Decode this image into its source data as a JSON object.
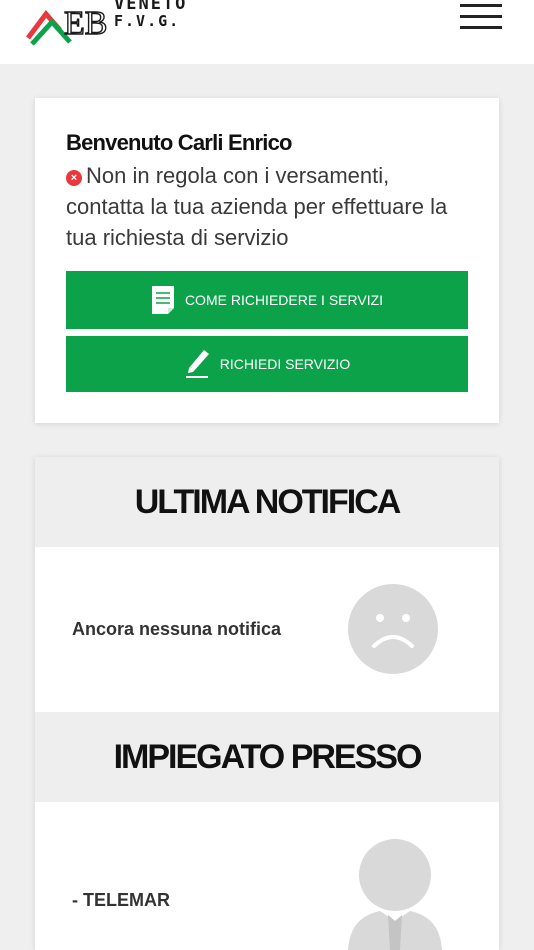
{
  "header": {
    "logo_top": "VENETO",
    "logo_bottom": "F.V.G."
  },
  "welcome": {
    "title": "Benvenuto Carli Enrico",
    "warning": "Non in regola con i versamenti, contatta la tua azienda per effettuare la tua richiesta di servizio",
    "buttons": [
      {
        "label": "COME RICHIEDERE I SERVIZI",
        "icon": "document-icon"
      },
      {
        "label": "RICHIEDI SERVIZIO",
        "icon": "pen-icon"
      }
    ]
  },
  "notifica": {
    "title": "ULTIMA NOTIFICA",
    "empty_text": "Ancora nessuna notifica",
    "icon": "sad-face-icon"
  },
  "impiegato": {
    "title": "IMPIEGATO PRESSO",
    "company": "- TELEMAR",
    "icon": "person-icon"
  },
  "colors": {
    "accent_green": "#0ba24a",
    "error_red": "#e8383d",
    "background": "#efefef"
  }
}
